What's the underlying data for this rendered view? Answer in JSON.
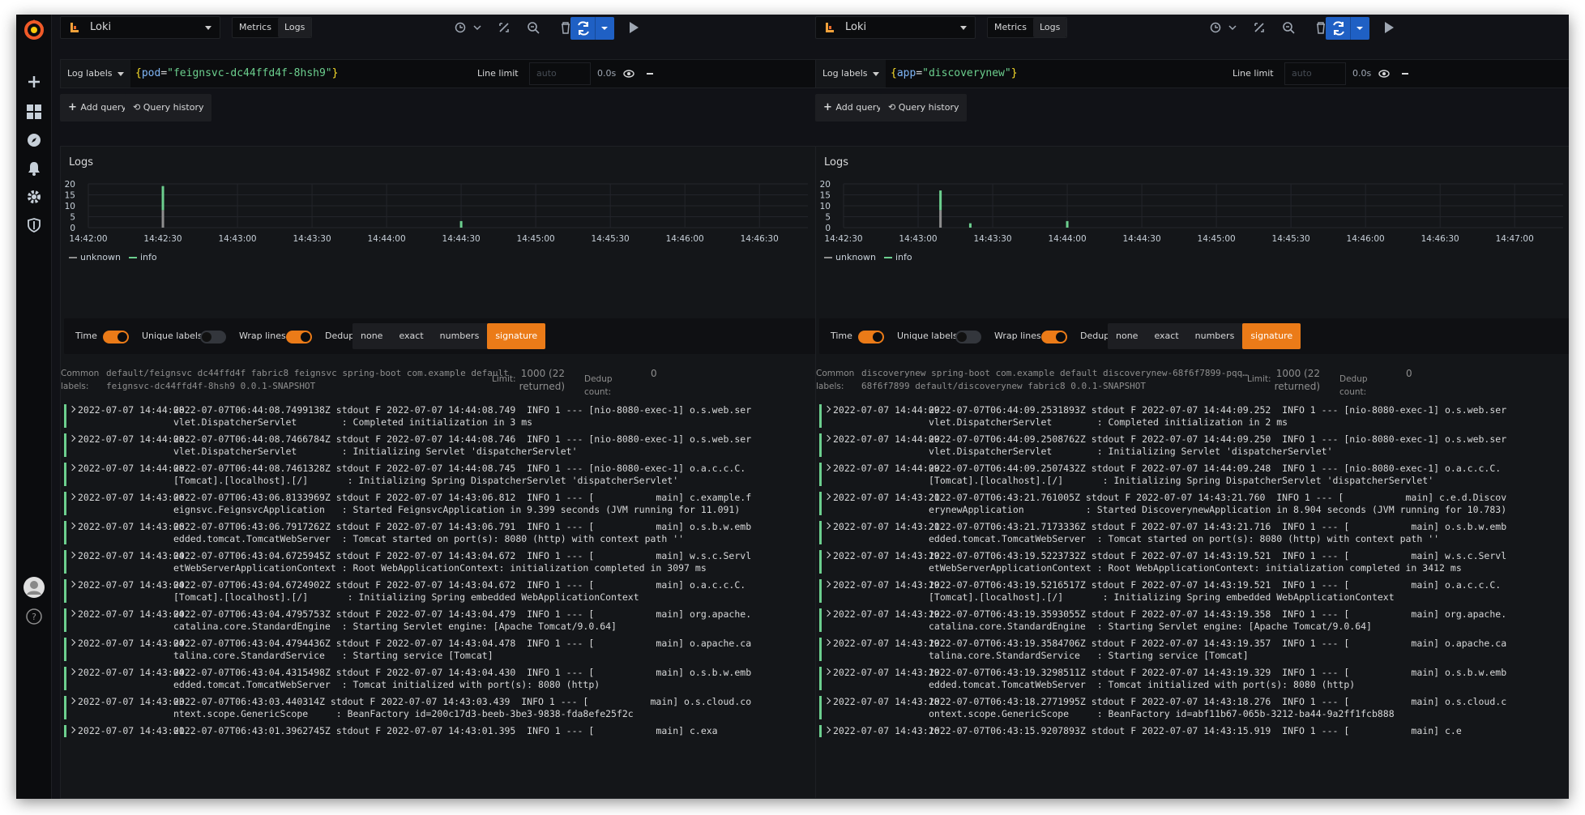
{
  "sidenav": {
    "items": [
      "plus-icon",
      "dashboards-icon",
      "explore-icon",
      "alerting-icon",
      "configuration-icon",
      "shield-icon",
      "avatar",
      "help-icon"
    ]
  },
  "colors": {
    "accent": "#eb7b18",
    "run": "#1f60c4",
    "info": "#6ccf8e",
    "unknown": "#8e8e8e"
  },
  "panes": [
    {
      "datasource": "Loki",
      "tab_metrics": "Metrics",
      "tab_logs": "Logs",
      "log_labels": "Log labels",
      "query": {
        "open": "{",
        "key": "pod",
        "eq": "=",
        "val": "\"feignsvc-dc44ffd4f-8hsh9\"",
        "close": "}"
      },
      "line_limit": "Line limit",
      "line_limit_placeholder": "auto",
      "query_time": "0.0s",
      "add_query": "Add query",
      "query_history": "Query history",
      "logs_title": "Logs",
      "y_ticks": [
        "20",
        "15",
        "10",
        "5",
        "0"
      ],
      "x_ticks": [
        "14:42:00",
        "14:42:30",
        "14:43:00",
        "14:43:30",
        "14:44:00",
        "14:44:30",
        "14:45:00",
        "14:45:30",
        "14:46:00",
        "14:46:30"
      ],
      "legend": [
        "unknown",
        "info"
      ],
      "opt_time": "Time",
      "opt_unique": "Unique labels",
      "opt_wrap": "Wrap lines",
      "opt_dedup": "Dedup",
      "dedup": [
        "none",
        "exact",
        "numbers",
        "signature"
      ],
      "common_label": "Common",
      "labels_label": "labels:",
      "common_line1": "default/feignsvc dc44ffd4f fabric8 feignsvc spring-boot com.example default",
      "common_line2": "feignsvc-dc44ffd4f-8hsh9 0.0.1-SNAPSHOT",
      "limit_label": "Limit:",
      "limit_value": "1000 (22",
      "limit_returned": "returned)",
      "dedup_count_label": "Dedup",
      "dedup_count_label2": "count:",
      "dedup_count": "0",
      "rows": [
        {
          "ts": "2022-07-07 14:44:08",
          "msg": "2022-07-07T06:44:08.7499138Z stdout F 2022-07-07 14:44:08.749  INFO 1 --- [nio-8080-exec-1] o.s.web.servlet.DispatcherServlet        : Completed initialization in 3 ms"
        },
        {
          "ts": "2022-07-07 14:44:08",
          "msg": "2022-07-07T06:44:08.7466784Z stdout F 2022-07-07 14:44:08.746  INFO 1 --- [nio-8080-exec-1] o.s.web.servlet.DispatcherServlet        : Initializing Servlet 'dispatcherServlet'"
        },
        {
          "ts": "2022-07-07 14:44:08",
          "msg": "2022-07-07T06:44:08.7461328Z stdout F 2022-07-07 14:44:08.745  INFO 1 --- [nio-8080-exec-1] o.a.c.c.C.[Tomcat].[localhost].[/]       : Initializing Spring DispatcherServlet 'dispatcherServlet'"
        },
        {
          "ts": "2022-07-07 14:43:06",
          "msg": "2022-07-07T06:43:06.8133969Z stdout F 2022-07-07 14:43:06.812  INFO 1 --- [           main] c.example.feignsvc.FeignsvcApplication   : Started FeignsvcApplication in 9.399 seconds (JVM running for 11.091)"
        },
        {
          "ts": "2022-07-07 14:43:06",
          "msg": "2022-07-07T06:43:06.7917262Z stdout F 2022-07-07 14:43:06.791  INFO 1 --- [           main] o.s.b.w.embedded.tomcat.TomcatWebServer  : Tomcat started on port(s): 8080 (http) with context path ''"
        },
        {
          "ts": "2022-07-07 14:43:04",
          "msg": "2022-07-07T06:43:04.6725945Z stdout F 2022-07-07 14:43:04.672  INFO 1 --- [           main] w.s.c.ServletWebServerApplicationContext : Root WebApplicationContext: initialization completed in 3097 ms"
        },
        {
          "ts": "2022-07-07 14:43:04",
          "msg": "2022-07-07T06:43:04.6724902Z stdout F 2022-07-07 14:43:04.672  INFO 1 --- [           main] o.a.c.c.C.[Tomcat].[localhost].[/]       : Initializing Spring embedded WebApplicationContext"
        },
        {
          "ts": "2022-07-07 14:43:04",
          "msg": "2022-07-07T06:43:04.4795753Z stdout F 2022-07-07 14:43:04.479  INFO 1 --- [           main] org.apache.catalina.core.StandardEngine  : Starting Servlet engine: [Apache Tomcat/9.0.64]"
        },
        {
          "ts": "2022-07-07 14:43:04",
          "msg": "2022-07-07T06:43:04.4794436Z stdout F 2022-07-07 14:43:04.478  INFO 1 --- [           main] o.apache.catalina.core.StandardService   : Starting service [Tomcat]"
        },
        {
          "ts": "2022-07-07 14:43:04",
          "msg": "2022-07-07T06:43:04.4315498Z stdout F 2022-07-07 14:43:04.430  INFO 1 --- [           main] o.s.b.w.embedded.tomcat.TomcatWebServer  : Tomcat initialized with port(s): 8080 (http)"
        },
        {
          "ts": "2022-07-07 14:43:03",
          "msg": "2022-07-07T06:43:03.440314Z stdout F 2022-07-07 14:43:03.439  INFO 1 --- [           main] o.s.cloud.context.scope.GenericScope     : BeanFactory id=200c17d3-beeb-3be3-9838-fda8efe25f2c"
        },
        {
          "ts": "2022-07-07 14:43:01",
          "msg": "2022-07-07T06:43:01.3962745Z stdout F 2022-07-07 14:43:01.395  INFO 1 --- [           main] c.exa"
        }
      ]
    },
    {
      "datasource": "Loki",
      "tab_metrics": "Metrics",
      "tab_logs": "Logs",
      "log_labels": "Log labels",
      "query": {
        "open": "{",
        "key": "app",
        "eq": "=",
        "val": "\"discoverynew\"",
        "close": "}"
      },
      "line_limit": "Line limit",
      "line_limit_placeholder": "auto",
      "query_time": "0.0s",
      "add_query": "Add query",
      "query_history": "Query history",
      "logs_title": "Logs",
      "y_ticks": [
        "20",
        "15",
        "10",
        "5",
        "0"
      ],
      "x_ticks": [
        "14:42:30",
        "14:43:00",
        "14:43:30",
        "14:44:00",
        "14:44:30",
        "14:45:00",
        "14:45:30",
        "14:46:00",
        "14:46:30",
        "14:47:00"
      ],
      "legend": [
        "unknown",
        "info"
      ],
      "opt_time": "Time",
      "opt_unique": "Unique labels",
      "opt_wrap": "Wrap lines",
      "opt_dedup": "Dedup",
      "dedup": [
        "none",
        "exact",
        "numbers",
        "signature"
      ],
      "common_label": "Common",
      "labels_label": "labels:",
      "common_line1": "discoverynew spring-boot com.example default discoverynew-68f6f7899-pqq…",
      "common_line2": "68f6f7899 default/discoverynew fabric8 0.0.1-SNAPSHOT",
      "limit_label": "Limit:",
      "limit_value": "1000 (22",
      "limit_returned": "returned)",
      "dedup_count_label": "Dedup",
      "dedup_count_label2": "count:",
      "dedup_count": "0",
      "rows": [
        {
          "ts": "2022-07-07 14:44:09",
          "msg": "2022-07-07T06:44:09.2531893Z stdout F 2022-07-07 14:44:09.252  INFO 1 --- [nio-8080-exec-1] o.s.web.servlet.DispatcherServlet        : Completed initialization in 2 ms"
        },
        {
          "ts": "2022-07-07 14:44:09",
          "msg": "2022-07-07T06:44:09.2508762Z stdout F 2022-07-07 14:44:09.250  INFO 1 --- [nio-8080-exec-1] o.s.web.servlet.DispatcherServlet        : Initializing Servlet 'dispatcherServlet'"
        },
        {
          "ts": "2022-07-07 14:44:09",
          "msg": "2022-07-07T06:44:09.2507432Z stdout F 2022-07-07 14:44:09.248  INFO 1 --- [nio-8080-exec-1] o.a.c.c.C.[Tomcat].[localhost].[/]       : Initializing Spring DispatcherServlet 'dispatcherServlet'"
        },
        {
          "ts": "2022-07-07 14:43:21",
          "msg": "2022-07-07T06:43:21.761005Z stdout F 2022-07-07 14:43:21.760  INFO 1 --- [           main] c.e.d.DiscoverynewApplication           : Started DiscoverynewApplication in 8.904 seconds (JVM running for 10.783)"
        },
        {
          "ts": "2022-07-07 14:43:21",
          "msg": "2022-07-07T06:43:21.7173336Z stdout F 2022-07-07 14:43:21.716  INFO 1 --- [           main] o.s.b.w.embedded.tomcat.TomcatWebServer  : Tomcat started on port(s): 8080 (http) with context path ''"
        },
        {
          "ts": "2022-07-07 14:43:19",
          "msg": "2022-07-07T06:43:19.5223732Z stdout F 2022-07-07 14:43:19.521  INFO 1 --- [           main] w.s.c.ServletWebServerApplicationContext : Root WebApplicationContext: initialization completed in 3412 ms"
        },
        {
          "ts": "2022-07-07 14:43:19",
          "msg": "2022-07-07T06:43:19.5216517Z stdout F 2022-07-07 14:43:19.521  INFO 1 --- [           main] o.a.c.c.C.[Tomcat].[localhost].[/]       : Initializing Spring embedded WebApplicationContext"
        },
        {
          "ts": "2022-07-07 14:43:19",
          "msg": "2022-07-07T06:43:19.3593055Z stdout F 2022-07-07 14:43:19.358  INFO 1 --- [           main] org.apache.catalina.core.StandardEngine  : Starting Servlet engine: [Apache Tomcat/9.0.64]"
        },
        {
          "ts": "2022-07-07 14:43:19",
          "msg": "2022-07-07T06:43:19.3584706Z stdout F 2022-07-07 14:43:19.357  INFO 1 --- [           main] o.apache.catalina.core.StandardService   : Starting service [Tomcat]"
        },
        {
          "ts": "2022-07-07 14:43:19",
          "msg": "2022-07-07T06:43:19.3298511Z stdout F 2022-07-07 14:43:19.329  INFO 1 --- [           main] o.s.b.w.embedded.tomcat.TomcatWebServer  : Tomcat initialized with port(s): 8080 (http)"
        },
        {
          "ts": "2022-07-07 14:43:18",
          "msg": "2022-07-07T06:43:18.2771995Z stdout F 2022-07-07 14:43:18.276  INFO 1 --- [           main] o.s.cloud.context.scope.GenericScope     : BeanFactory id=abf11b67-065b-3212-ba44-9a2ff1fcb888"
        },
        {
          "ts": "2022-07-07 14:43:16",
          "msg": "2022-07-07T06:43:15.9207893Z stdout F 2022-07-07 14:43:15.919  INFO 1 --- [           main] c.e"
        }
      ]
    }
  ]
}
